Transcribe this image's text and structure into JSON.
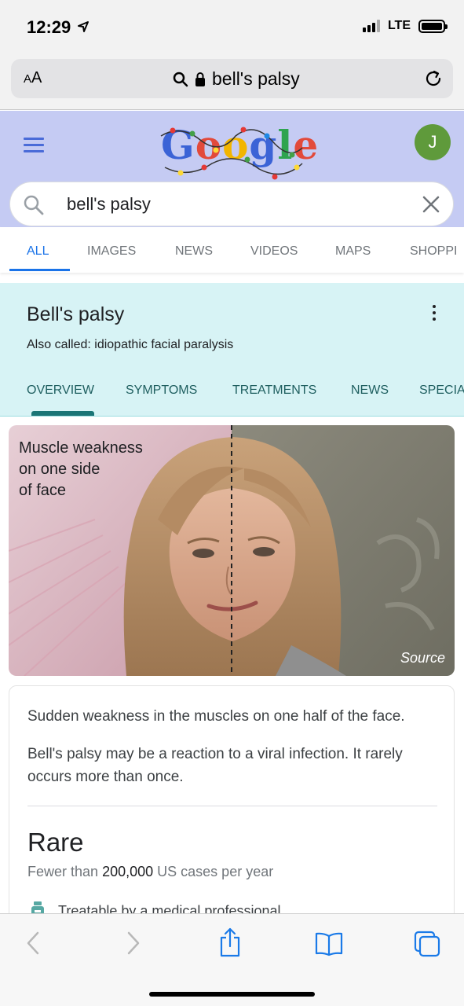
{
  "status_bar": {
    "time": "12:29",
    "network": "LTE"
  },
  "browser": {
    "text_size_button": "AA",
    "url_text": "bell's palsy"
  },
  "google": {
    "logo_text": "Google",
    "avatar_initial": "J",
    "search_query": "bell's palsy",
    "tabs": [
      "ALL",
      "IMAGES",
      "NEWS",
      "VIDEOS",
      "MAPS",
      "SHOPPI"
    ]
  },
  "knowledge_panel": {
    "title": "Bell's palsy",
    "also_called": "Also called: idiopathic facial paralysis",
    "tabs": [
      "OVERVIEW",
      "SYMPTOMS",
      "TREATMENTS",
      "NEWS",
      "SPECIA"
    ]
  },
  "image": {
    "caption": [
      "Muscle weakness",
      "on one side",
      "of face"
    ],
    "source_label": "Source"
  },
  "card": {
    "summary": "Sudden weakness in the muscles on one half of the face.",
    "detail": "Bell's palsy may be a reaction to a viral infection. It rarely occurs more than once.",
    "rarity": "Rare",
    "cases_prefix": "Fewer than",
    "cases_number": "200,000",
    "cases_suffix": "US cases per year",
    "treatable": "Treatable by a medical professional"
  },
  "colors": {
    "accent": "#1a73e8",
    "header_bg": "#c5cbf3",
    "panel_bg": "#d7f3f5",
    "panel_accent": "#1b7576",
    "avatar": "#5f9a3b"
  }
}
